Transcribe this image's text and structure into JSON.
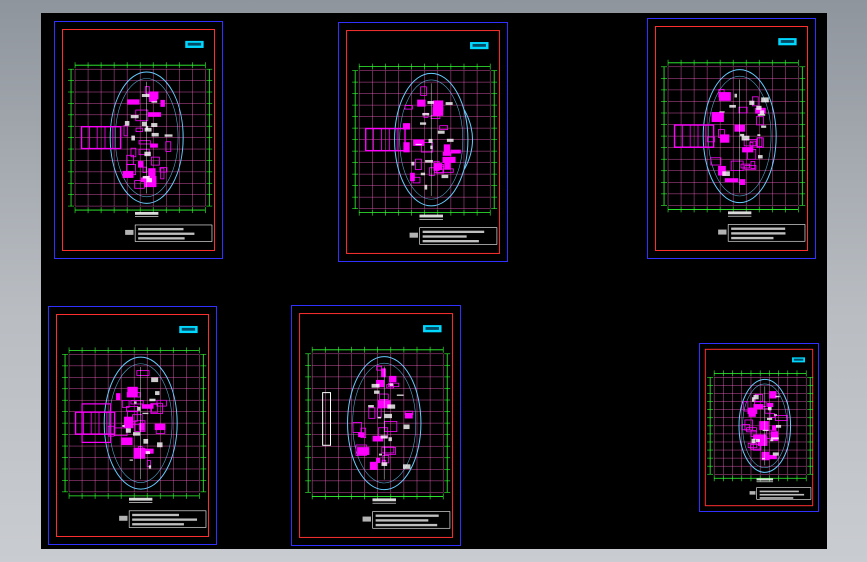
{
  "viewer": {
    "background": "#000000",
    "sheet_border_color": "#3030ff",
    "inner_frame_color": "#ff3030",
    "grid_color": "#ff66cc",
    "dimension_color": "#33ff33",
    "wall_color": "#ff00ff",
    "outline_color": "#66ccff",
    "title_tag_color": "#00d8ff"
  },
  "sheets": [
    {
      "id": "sheet-1",
      "variant": "left-wing"
    },
    {
      "id": "sheet-2",
      "variant": "left-wing-arc"
    },
    {
      "id": "sheet-3",
      "variant": "left-wing"
    },
    {
      "id": "sheet-4",
      "variant": "cross"
    },
    {
      "id": "sheet-5",
      "variant": "left-box"
    },
    {
      "id": "sheet-6",
      "variant": "oval"
    }
  ]
}
